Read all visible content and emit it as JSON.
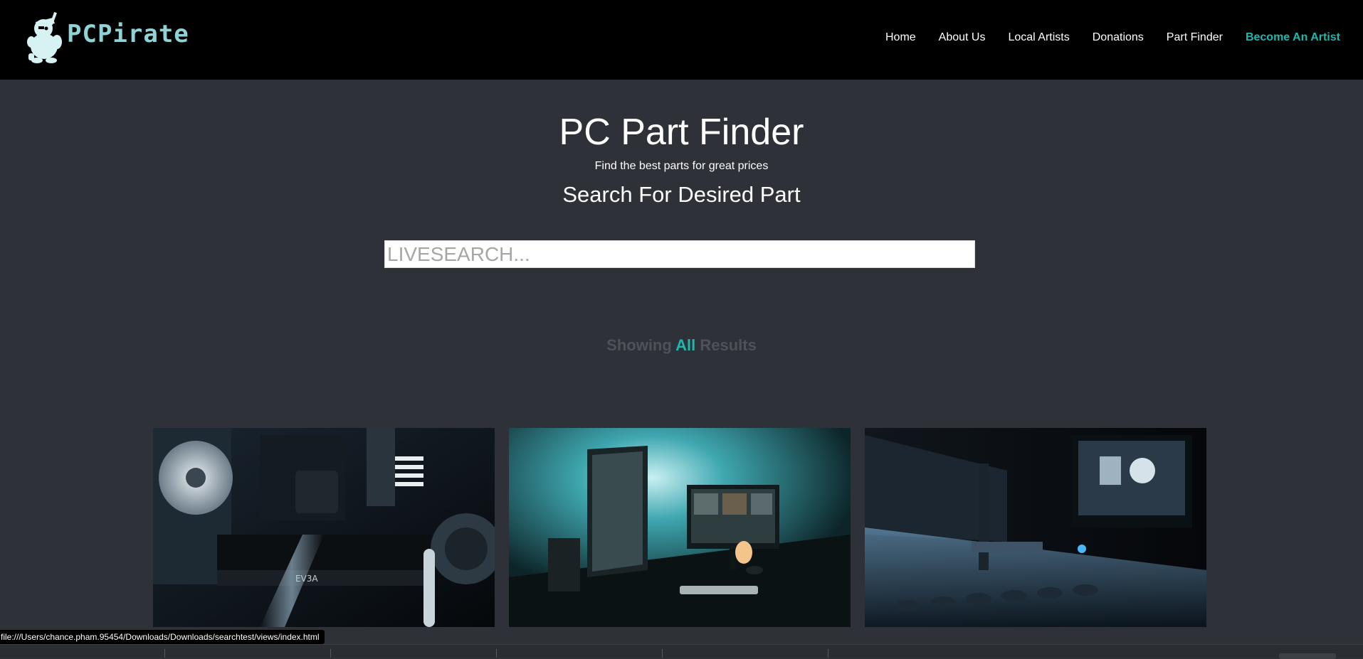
{
  "brand": {
    "name": "PCPirate"
  },
  "nav": {
    "items": [
      {
        "label": "Home"
      },
      {
        "label": "About Us"
      },
      {
        "label": "Local Artists"
      },
      {
        "label": "Donations"
      },
      {
        "label": "Part Finder"
      },
      {
        "label": "Become An Artist"
      }
    ]
  },
  "hero": {
    "title": "PC Part Finder",
    "subtitle": "Find the best parts for great prices",
    "search_heading": "Search For Desired Part",
    "search_placeholder": "LIVESEARCH..."
  },
  "results": {
    "prefix": "Showing",
    "filter": "All",
    "suffix": "Results"
  },
  "gallery": {
    "items": [
      {
        "icon": "gpu-case-photo"
      },
      {
        "icon": "desk-setup-photo"
      },
      {
        "icon": "pc-tower-photo"
      }
    ]
  },
  "statusbar": {
    "url": "file:///Users/chance.pham.95454/Downloads/Downloads/searchtest/views/index.html"
  },
  "colors": {
    "accent": "#1fb7ad",
    "page_bg": "#2e3238",
    "nav_bg": "#000000",
    "logo": "#8fd3d6"
  }
}
